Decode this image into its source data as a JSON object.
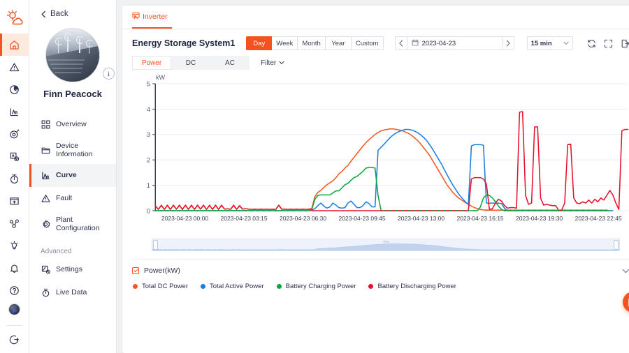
{
  "rail": {
    "logo_icon": "sun-cloud-logo-icon",
    "items": [
      {
        "name": "home",
        "icon": "home-icon",
        "active": true
      },
      {
        "name": "alarm",
        "icon": "warning-triangle-icon",
        "active": false
      },
      {
        "name": "history",
        "icon": "clock-icon",
        "active": false
      },
      {
        "name": "report",
        "icon": "chart-bars-icon",
        "active": false
      },
      {
        "name": "target",
        "icon": "target-icon",
        "active": false
      },
      {
        "name": "device-check",
        "icon": "device-check-icon",
        "active": false
      },
      {
        "name": "timer",
        "icon": "stopwatch-icon",
        "active": false
      },
      {
        "name": "upload",
        "icon": "upload-box-icon",
        "active": false
      },
      {
        "name": "nodes",
        "icon": "nodes-link-icon",
        "active": false
      },
      {
        "name": "bulb",
        "icon": "lightbulb-icon",
        "active": false
      },
      {
        "name": "notifications",
        "icon": "bell-icon",
        "active": false
      },
      {
        "name": "help",
        "icon": "question-circle-icon",
        "active": false
      }
    ],
    "account_icon": "user-avatar-icon",
    "logout_icon": "logout-icon"
  },
  "nav": {
    "back_label": "Back",
    "back_icon": "chevron-left-icon",
    "user_name": "Finn Peacock",
    "avatar_badge": "i",
    "items": [
      {
        "label": "Overview",
        "icon": "grid-squares-icon",
        "active": false
      },
      {
        "label": "Device Information",
        "icon": "folder-icon",
        "active": false
      },
      {
        "label": "Curve",
        "icon": "curve-chart-icon",
        "active": true
      },
      {
        "label": "Fault",
        "icon": "warning-triangle-icon",
        "active": false
      },
      {
        "label": "Plant Configuration",
        "icon": "gear-icon",
        "active": false
      }
    ],
    "section_label": "Advanced",
    "advanced_items": [
      {
        "label": "Settings",
        "icon": "settings-sliders-icon",
        "active": false
      },
      {
        "label": "Live Data",
        "icon": "stopwatch-icon",
        "active": false
      }
    ]
  },
  "header": {
    "device_tab": "Inverter",
    "device_tab_icon": "inverter-icon",
    "system_title": "Energy Storage System1",
    "ranges": [
      {
        "label": "Day",
        "active": true
      },
      {
        "label": "Week",
        "active": false
      },
      {
        "label": "Month",
        "active": false
      },
      {
        "label": "Year",
        "active": false
      },
      {
        "label": "Custom",
        "active": false
      }
    ],
    "prev_icon": "chevron-left-icon",
    "next_icon": "chevron-right-icon",
    "calendar_icon": "calendar-icon",
    "date_value": "2023-04-23",
    "interval_value": "15 min",
    "interval_icon": "chevron-down-icon",
    "tools": [
      {
        "name": "refresh-icon",
        "label": "Refresh"
      },
      {
        "name": "fullscreen-icon",
        "label": "Fullscreen"
      },
      {
        "name": "export-icon",
        "label": "Export"
      }
    ],
    "subtabs": [
      {
        "label": "Power",
        "active": true
      },
      {
        "label": "DC",
        "active": false
      },
      {
        "label": "AC",
        "active": false
      }
    ],
    "filter_label": "Filter",
    "filter_icon": "chevron-down-icon"
  },
  "footer": {
    "group_label": "Power(kW)",
    "checkbox_icon": "check-icon",
    "collapse_icon": "chevron-down-icon",
    "fab_icon": "feedback-form-icon"
  },
  "chart_data": {
    "type": "line",
    "title": "",
    "xlabel": "",
    "ylabel": "kW",
    "ylim": [
      0,
      5
    ],
    "yticks": [
      0,
      1,
      2,
      3,
      4,
      5
    ],
    "grid": true,
    "legend_position": "bottom",
    "xticks": [
      "2023-04-23 00:00",
      "2023-04-23 03:15",
      "2023-04-23 06:30",
      "2023-04-23 09:45",
      "2023-04-23 13:00",
      "2023-04-23 16:15",
      "2023-04-23 19:30",
      "2023-04-23 22:45"
    ],
    "x_start": "2023-04-23 00:00",
    "x_end": "2023-04-23 23:45",
    "x_interval_minutes": 15,
    "series": [
      {
        "name": "Total DC Power",
        "color": "#ee5a24",
        "values": [
          0.18,
          0.05,
          0.2,
          0.05,
          0.2,
          0.05,
          0.2,
          0.06,
          0.2,
          0.05,
          0.2,
          0.05,
          0.2,
          0.05,
          0.2,
          0.06,
          0.2,
          0.05,
          0.2,
          0.05,
          0.2,
          0.05,
          0.2,
          0.06,
          0.08,
          0.05,
          0.2,
          0.05,
          0.18,
          0.06,
          0.08,
          0.06,
          0.05,
          0.06,
          0.05,
          0.06,
          0.05,
          0.06,
          0.05,
          0.06,
          0.05,
          0.2,
          0.06,
          0.06,
          0.05,
          0.06,
          0.05,
          0.06,
          0.05,
          0.06,
          0.05,
          0.06,
          0.1,
          0.55,
          0.72,
          0.8,
          0.92,
          1.02,
          1.1,
          1.18,
          1.3,
          1.45,
          1.55,
          1.68,
          1.78,
          1.95,
          2.1,
          2.25,
          2.4,
          2.55,
          2.68,
          2.8,
          2.9,
          3.0,
          3.08,
          3.14,
          3.18,
          3.2,
          3.22,
          3.22,
          3.2,
          3.18,
          3.15,
          3.1,
          3.05,
          2.98,
          2.88,
          2.78,
          2.65,
          2.5,
          2.35,
          2.2,
          2.0,
          1.8,
          1.6,
          1.4,
          1.2,
          1.0,
          0.85,
          0.7,
          0.58,
          0.48,
          0.4,
          0.32,
          0.25,
          0.18,
          0.12,
          0.08,
          0.05,
          0.03,
          0.02,
          0.02,
          0.02,
          0.02,
          0.02,
          0.02,
          0.02,
          0.02,
          0.02,
          0.02,
          0.02,
          0.02,
          0.02,
          0.02,
          0.02,
          0.02,
          0.02,
          0.02,
          0.02,
          0.02,
          0.02,
          0.02,
          0.02,
          0.02,
          0.02,
          0.02,
          0.02,
          0.02,
          0.02,
          0.02,
          0.02,
          0.02,
          0.02,
          0.02,
          0.02,
          0.02,
          0.02,
          0.02,
          0.02,
          0.02,
          0.02
        ]
      },
      {
        "name": "Total Active Power",
        "color": "#1a7fe0",
        "values": [
          0,
          0,
          0,
          0,
          0,
          0,
          0,
          0,
          0,
          0,
          0,
          0,
          0,
          0,
          0,
          0,
          0,
          0,
          0,
          0,
          0,
          0,
          0,
          0,
          0,
          0,
          0,
          0,
          0,
          0,
          0,
          0,
          0,
          0,
          0,
          0,
          0,
          0,
          0,
          0,
          0,
          0,
          0,
          0,
          0,
          0,
          0,
          0,
          0,
          0,
          0,
          0,
          0.02,
          0.08,
          0.2,
          0.3,
          0.18,
          0.1,
          0.15,
          0.3,
          0.22,
          0.12,
          0.1,
          0.12,
          0.3,
          0.38,
          0.25,
          0.12,
          0.12,
          0.2,
          0.35,
          0.28,
          0.15,
          0.15,
          2.38,
          2.5,
          2.62,
          2.75,
          2.88,
          2.98,
          3.06,
          3.12,
          3.16,
          3.2,
          3.2,
          3.18,
          3.14,
          3.08,
          3.0,
          2.9,
          2.78,
          2.62,
          2.45,
          2.25,
          2.05,
          1.85,
          1.62,
          1.4,
          1.18,
          0.98,
          0.8,
          0.62,
          0.48,
          0.35,
          0.24,
          2.55,
          2.6,
          2.6,
          2.6,
          2.58,
          0.3,
          0.3,
          0.3,
          0.3,
          0.3,
          0.28,
          0.1,
          0,
          0,
          0,
          0,
          0,
          0,
          0,
          0,
          0,
          0,
          0,
          0,
          0,
          0,
          0,
          0,
          0,
          0,
          0,
          0,
          0,
          0,
          0,
          0,
          0,
          0,
          0,
          0,
          0,
          0,
          0,
          0,
          0,
          0,
          0,
          0
        ]
      },
      {
        "name": "Battery Charging Power",
        "color": "#0aa53c",
        "values": [
          0,
          0,
          0,
          0,
          0,
          0,
          0,
          0,
          0,
          0,
          0,
          0,
          0,
          0,
          0,
          0,
          0,
          0,
          0,
          0,
          0,
          0,
          0,
          0,
          0,
          0,
          0,
          0,
          0,
          0,
          0,
          0,
          0,
          0,
          0,
          0,
          0,
          0,
          0,
          0,
          0,
          0,
          0,
          0,
          0,
          0,
          0,
          0,
          0,
          0,
          0,
          0,
          0.05,
          0.45,
          0.6,
          0.62,
          0.62,
          0.62,
          0.62,
          0.7,
          0.78,
          0.78,
          0.9,
          1.02,
          1.08,
          1.2,
          1.3,
          1.35,
          1.45,
          1.55,
          1.68,
          1.7,
          1.7,
          1.68,
          0.6,
          0,
          0,
          0,
          0,
          0,
          0,
          0,
          0,
          0,
          0,
          0,
          0,
          0,
          0,
          0,
          0,
          0,
          0,
          0,
          0,
          0,
          0,
          0,
          0,
          0,
          0,
          0,
          0,
          0,
          0,
          0,
          0,
          0,
          0.15,
          0.5,
          0.62,
          0.6,
          0.5,
          0.35,
          0.18,
          0.05,
          0,
          0,
          0,
          0,
          0,
          0,
          0,
          0,
          0,
          0,
          0,
          0,
          0,
          0,
          0,
          0,
          0,
          0,
          0,
          0,
          0,
          0,
          0,
          0,
          0,
          0,
          0,
          0,
          0,
          0,
          0,
          0,
          0,
          0,
          0,
          0
        ]
      },
      {
        "name": "Battery Discharging Power",
        "color": "#e8112d",
        "values": [
          0.2,
          0.05,
          0.22,
          0.05,
          0.22,
          0.05,
          0.22,
          0.06,
          0.22,
          0.05,
          0.22,
          0.05,
          0.22,
          0.05,
          0.22,
          0.06,
          0.22,
          0.05,
          0.22,
          0.05,
          0.22,
          0.05,
          0.22,
          0.06,
          0.08,
          0.05,
          0.22,
          0.05,
          0.2,
          0.06,
          0.08,
          0.06,
          0.05,
          0.06,
          0.05,
          0.06,
          0.05,
          0.06,
          0.05,
          0.06,
          0.05,
          0.22,
          0.06,
          0.06,
          0.05,
          0.06,
          0.05,
          0.06,
          0.05,
          0.06,
          0.05,
          0.06,
          0,
          0,
          0,
          0,
          0,
          0,
          0,
          0,
          0,
          0,
          0,
          0,
          0,
          0,
          0,
          0,
          0,
          0,
          0,
          0,
          0,
          0,
          0,
          0,
          0,
          0,
          0,
          0,
          0,
          0,
          0,
          0,
          0,
          0,
          0,
          0,
          0,
          0,
          0,
          0,
          0,
          0,
          0,
          0,
          0,
          0,
          0,
          0,
          0,
          0,
          0,
          0,
          0,
          1.25,
          1.3,
          1.3,
          1.3,
          1.25,
          1.05,
          0.05,
          0.08,
          0.3,
          0.45,
          0.38,
          0.2,
          0.1,
          0.12,
          0.12,
          0.1,
          3.88,
          3.9,
          0.6,
          0.25,
          0.3,
          3.3,
          3.3,
          0.5,
          0.22,
          0.25,
          0.22,
          0.2,
          0.2,
          0.02,
          0.02,
          0.3,
          2.6,
          2.62,
          0.5,
          0.3,
          0.28,
          0.35,
          0.3,
          0.42,
          0.3,
          0.45,
          0.35,
          0.5,
          0.42,
          0.6,
          0.8,
          0.62,
          0.3,
          0.05,
          3.15,
          3.2,
          3.2
        ]
      }
    ]
  }
}
